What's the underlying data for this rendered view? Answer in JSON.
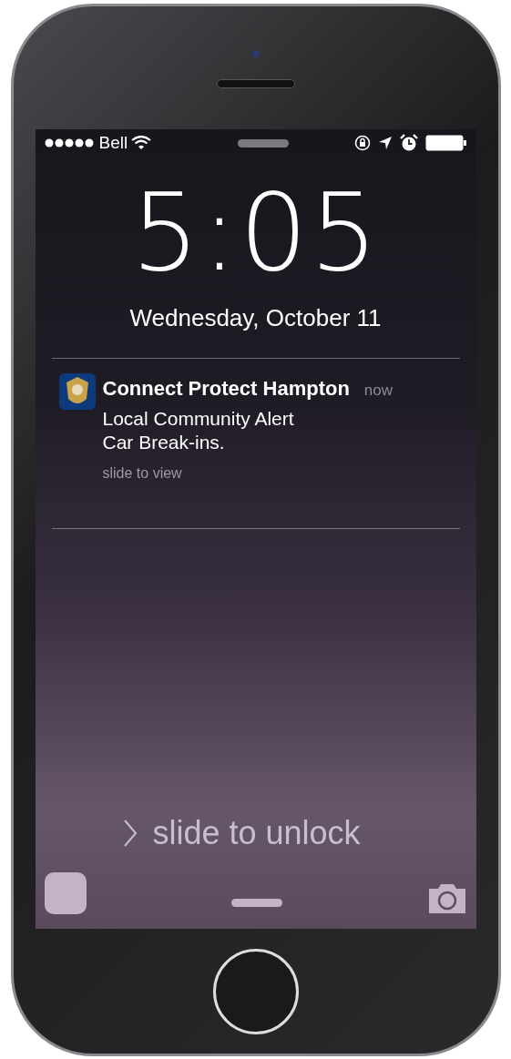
{
  "status_bar": {
    "carrier": "Bell"
  },
  "lock_screen": {
    "time": "5:05",
    "date": "Wednesday, October 11"
  },
  "notification": {
    "app": "Connect Protect Hampton",
    "time": "now",
    "lines": [
      "Local Community Alert",
      "Car Break-ins."
    ],
    "action": "slide to view"
  },
  "unlock": {
    "label": "slide to unlock"
  }
}
